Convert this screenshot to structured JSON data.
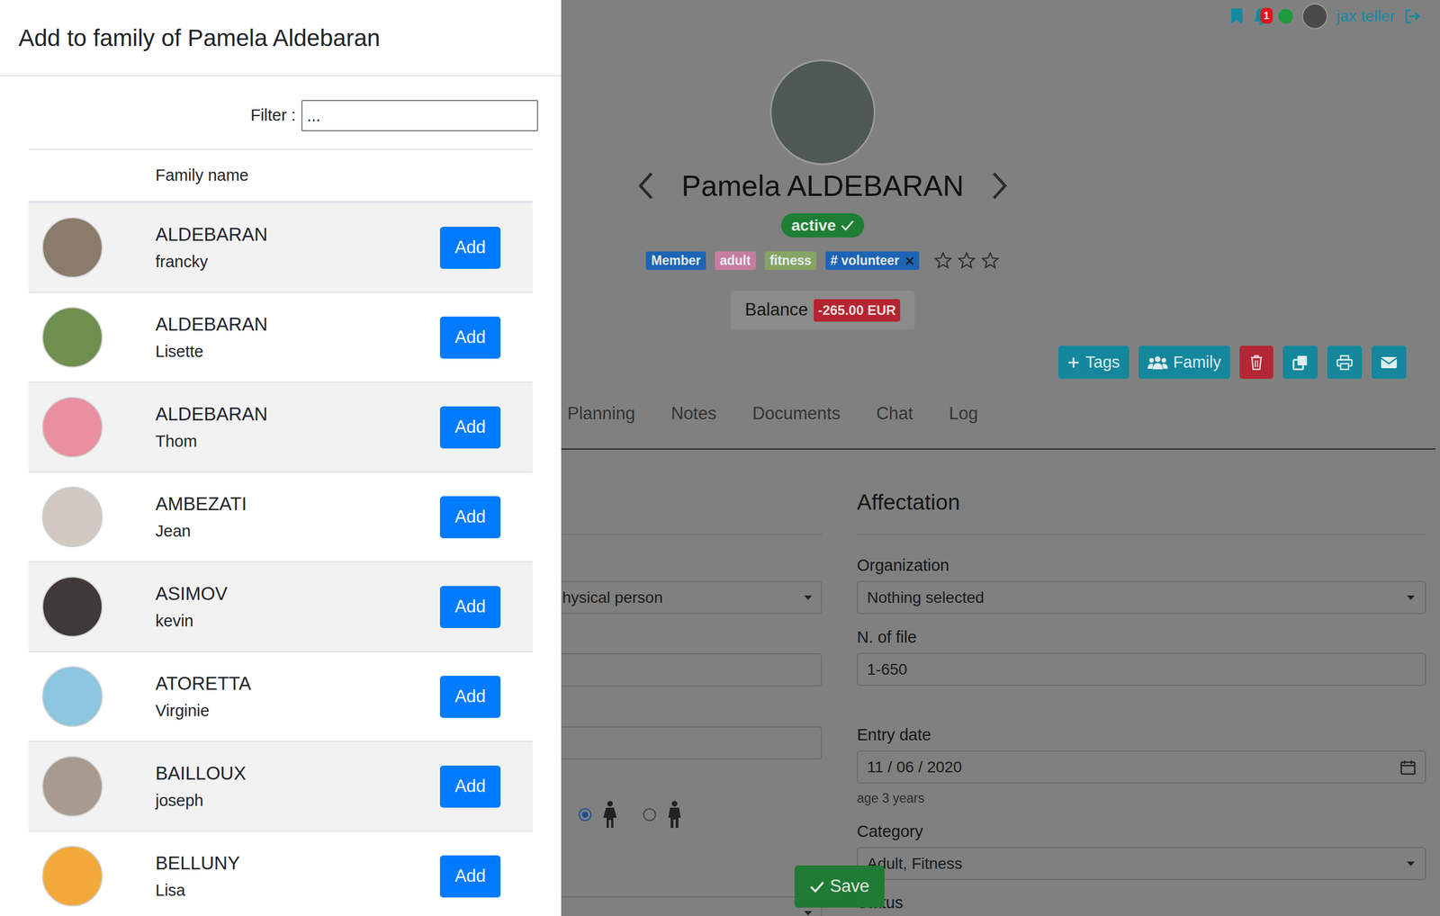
{
  "drawer": {
    "title": "Add to family of Pamela Aldebaran",
    "filter": {
      "label": "Filter :",
      "placeholder": "..."
    },
    "columns": [
      "Family name"
    ],
    "rows": [
      {
        "last_name": "ALDEBARAN",
        "first_name": "francky",
        "button": "Add"
      },
      {
        "last_name": "ALDEBARAN",
        "first_name": "Lisette",
        "button": "Add"
      },
      {
        "last_name": "ALDEBARAN",
        "first_name": "Thom",
        "button": "Add"
      },
      {
        "last_name": "AMBEZATI",
        "first_name": "Jean",
        "button": "Add"
      },
      {
        "last_name": "ASIMOV",
        "first_name": "kevin",
        "button": "Add"
      },
      {
        "last_name": "ATORETTA",
        "first_name": "Virginie",
        "button": "Add"
      },
      {
        "last_name": "BAILLOUX",
        "first_name": "joseph",
        "button": "Add"
      },
      {
        "last_name": "BELLUNY",
        "first_name": "Lisa",
        "button": "Add"
      }
    ]
  },
  "topbar": {
    "notifications": "1",
    "user": "jax teller"
  },
  "profile": {
    "name": "Pamela ALDEBARAN",
    "status": "active",
    "tags": [
      {
        "label": "Member",
        "color": "#1d64b5",
        "removable": false
      },
      {
        "label": "adult",
        "color": "#c77d9f",
        "removable": false
      },
      {
        "label": "fitness",
        "color": "#86a463",
        "removable": false
      },
      {
        "label": "# volunteer",
        "color": "#1d64b5",
        "removable": true
      }
    ],
    "stars": 0,
    "balance": {
      "label": "Balance",
      "value": "-265.00 EUR"
    }
  },
  "actions": [
    "Tags",
    "Family"
  ],
  "tabs": [
    {
      "label": "Planning",
      "selected": false
    },
    {
      "label": "Notes",
      "selected": false
    },
    {
      "label": "Documents",
      "selected": false
    },
    {
      "label": "Chat",
      "selected": false
    },
    {
      "label": "Log",
      "selected": false
    }
  ],
  "form": {
    "left": [
      {
        "kind": "select",
        "value": "hysical person"
      },
      {
        "kind": "input",
        "value": ""
      },
      {
        "kind": "input",
        "value": ""
      },
      {
        "kind": "radio",
        "options": [
          {
            "selected": true
          },
          {
            "selected": false
          }
        ]
      },
      {
        "kind": "select",
        "value": ""
      }
    ],
    "section": "Affectation",
    "fields": [
      {
        "label": "Organization",
        "kind": "select",
        "value": "Nothing selected"
      },
      {
        "label": "N. of file",
        "kind": "input",
        "value": "1-650"
      },
      {
        "label": "Entry date",
        "kind": "date",
        "value": "11 / 06 / 2020",
        "hint": "age 3 years"
      },
      {
        "label": "Category",
        "kind": "select",
        "value": "Adult, Fitness"
      },
      {
        "label": "Status",
        "kind": "label"
      }
    ]
  },
  "save": "Save"
}
